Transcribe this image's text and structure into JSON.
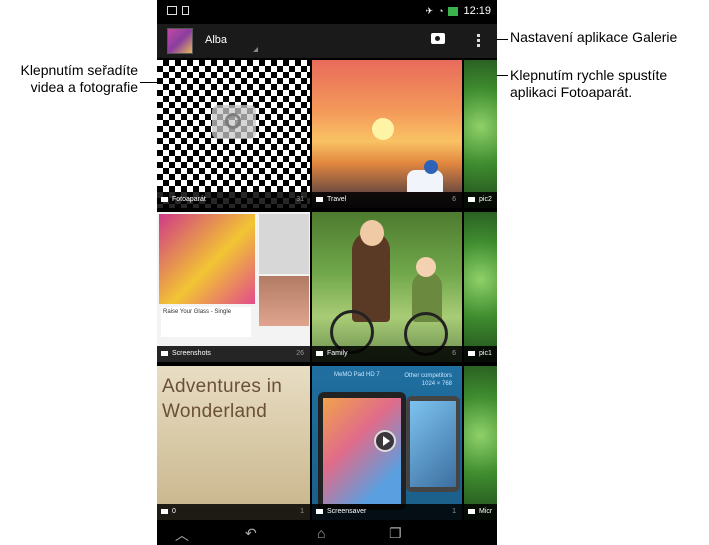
{
  "status_bar": {
    "time": "12:19",
    "icons": [
      "image-icon",
      "sim-icon",
      "mute-icon",
      "wifi-icon",
      "battery-icon"
    ]
  },
  "action_bar": {
    "title": "Alba",
    "actions": [
      "camera-icon",
      "overflow-menu-icon"
    ]
  },
  "albums": [
    {
      "name": "Fotoaparát",
      "count": "31",
      "type": "camera"
    },
    {
      "name": "Travel",
      "count": "6",
      "type": "folder"
    },
    {
      "name": "pic2",
      "count": "",
      "type": "folder"
    },
    {
      "name": "Screenshots",
      "count": "26",
      "type": "folder"
    },
    {
      "name": "Family",
      "count": "6",
      "type": "folder"
    },
    {
      "name": "pic1",
      "count": "",
      "type": "folder"
    },
    {
      "name": "0",
      "count": "1",
      "type": "folder"
    },
    {
      "name": "Screensaver",
      "count": "1",
      "type": "folder"
    },
    {
      "name": "Micr",
      "count": "",
      "type": "folder"
    }
  ],
  "thumb_text": {
    "book": "Adventures in Wonderland",
    "screensaver_left": "MeMO Pad HD 7",
    "screensaver_right": "Other competitors 1024 × 768",
    "screenshots_caption": "Raise Your Glass - Single"
  },
  "navigation": [
    "back-icon",
    "home-icon",
    "recents-icon"
  ],
  "callouts": {
    "sort": "Klepnutím seřadíte videa a fotografie",
    "settings": "Nastavení aplikace Galerie",
    "camera": "Klepnutím rychle spustíte aplikaci Fotoaparát."
  }
}
